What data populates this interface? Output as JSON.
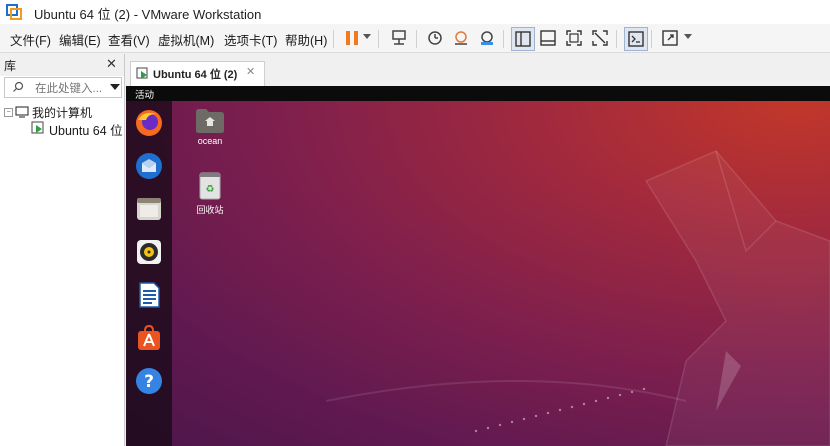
{
  "window": {
    "title": "Ubuntu 64 位 (2) - VMware Workstation"
  },
  "menu": {
    "file": "文件(F)",
    "edit": "编辑(E)",
    "view": "查看(V)",
    "vm": "虚拟机(M)",
    "tabs": "选项卡(T)",
    "help": "帮助(H)"
  },
  "library": {
    "title": "库",
    "search_placeholder": "在此处键入...",
    "tree": {
      "root": "我的计算机",
      "child": "Ubuntu 64 位"
    }
  },
  "tab": {
    "label": "Ubuntu 64 位 (2)"
  },
  "guest": {
    "activities": "活动",
    "desktop_icons": [
      "ocean",
      "回收站"
    ],
    "dock_apps": [
      "firefox-icon",
      "thunderbird-icon",
      "files-icon",
      "rhythmbox-icon",
      "libreoffice-writer-icon",
      "software-icon",
      "help-icon"
    ]
  },
  "colors": {
    "pause_orange": "#f07a20",
    "ubuntu_red": "#c2372a",
    "ubuntu_purple": "#5f1950"
  }
}
